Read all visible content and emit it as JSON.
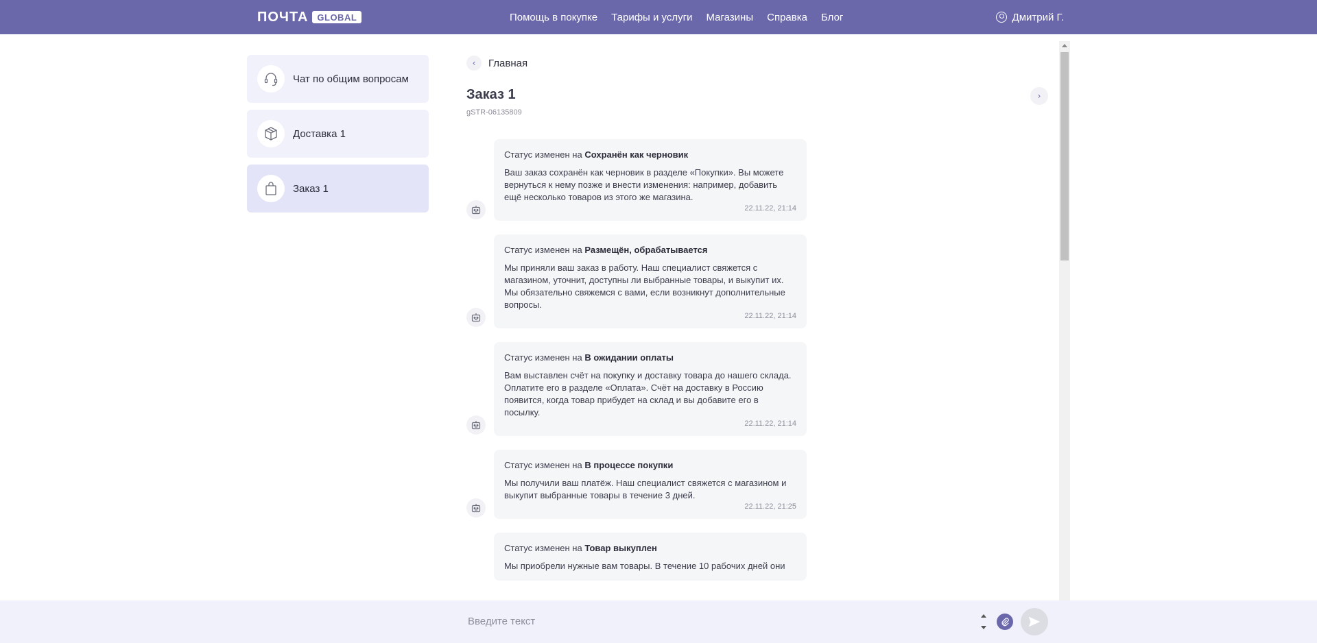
{
  "header": {
    "logo_text": "ПОЧТА",
    "logo_badge": "GLOBAL",
    "nav": [
      "Помощь в покупке",
      "Тарифы и услуги",
      "Магазины",
      "Справка",
      "Блог"
    ],
    "user_name": "Дмитрий Г."
  },
  "sidebar": {
    "items": [
      {
        "label": "Чат по общим вопросам",
        "icon": "headset-icon"
      },
      {
        "label": "Доставка 1",
        "icon": "box-icon"
      },
      {
        "label": "Заказ 1",
        "icon": "shopping-bag-icon",
        "active": true
      }
    ]
  },
  "main": {
    "back_label": "Главная",
    "title": "Заказ 1",
    "subtitle": "gSTR-06135809"
  },
  "messages": [
    {
      "status_prefix": "Статус изменен на",
      "status_value": "Сохранён как черновик",
      "text": "Ваш заказ сохранён как черновик в разделе «Покупки». Вы можете вернуться к нему позже и внести изменения: например, добавить ещё несколько товаров из этого же магазина.",
      "time": "22.11.22, 21:14"
    },
    {
      "status_prefix": "Статус изменен на",
      "status_value": "Размещён, обрабатывается",
      "text": "Мы приняли ваш заказ в работу. Наш специалист свяжется с магазином, уточнит, доступны ли выбранные товары, и выкупит их. Мы обязательно свяжемся с вами, если возникнут дополнительные вопросы.",
      "time": "22.11.22, 21:14"
    },
    {
      "status_prefix": "Статус изменен на",
      "status_value": "В ожидании оплаты",
      "text": "Вам выставлен счёт на покупку и доставку товара до нашего склада. Оплатите его в разделе «Оплата». Счёт на доставку в Россию появится, когда товар прибудет на склад и вы добавите его в посылку.",
      "time": "22.11.22, 21:14"
    },
    {
      "status_prefix": "Статус изменен на",
      "status_value": "В процессе покупки",
      "text": "Мы получили ваш платёж. Наш специалист свяжется с магазином и выкупит выбранные товары в течение 3 дней.",
      "time": "22.11.22, 21:25"
    },
    {
      "status_prefix": "Статус изменен на",
      "status_value": "Товар выкуплен",
      "text": "Мы приобрели нужные вам товары. В течение 10 рабочих дней они",
      "time": ""
    }
  ],
  "composer": {
    "placeholder": "Введите текст"
  },
  "colors": {
    "header": "#6a68ab",
    "sidebar_item": "#f1f1fb",
    "sidebar_active": "#e4e4f8",
    "bubble": "#f5f6f8"
  }
}
